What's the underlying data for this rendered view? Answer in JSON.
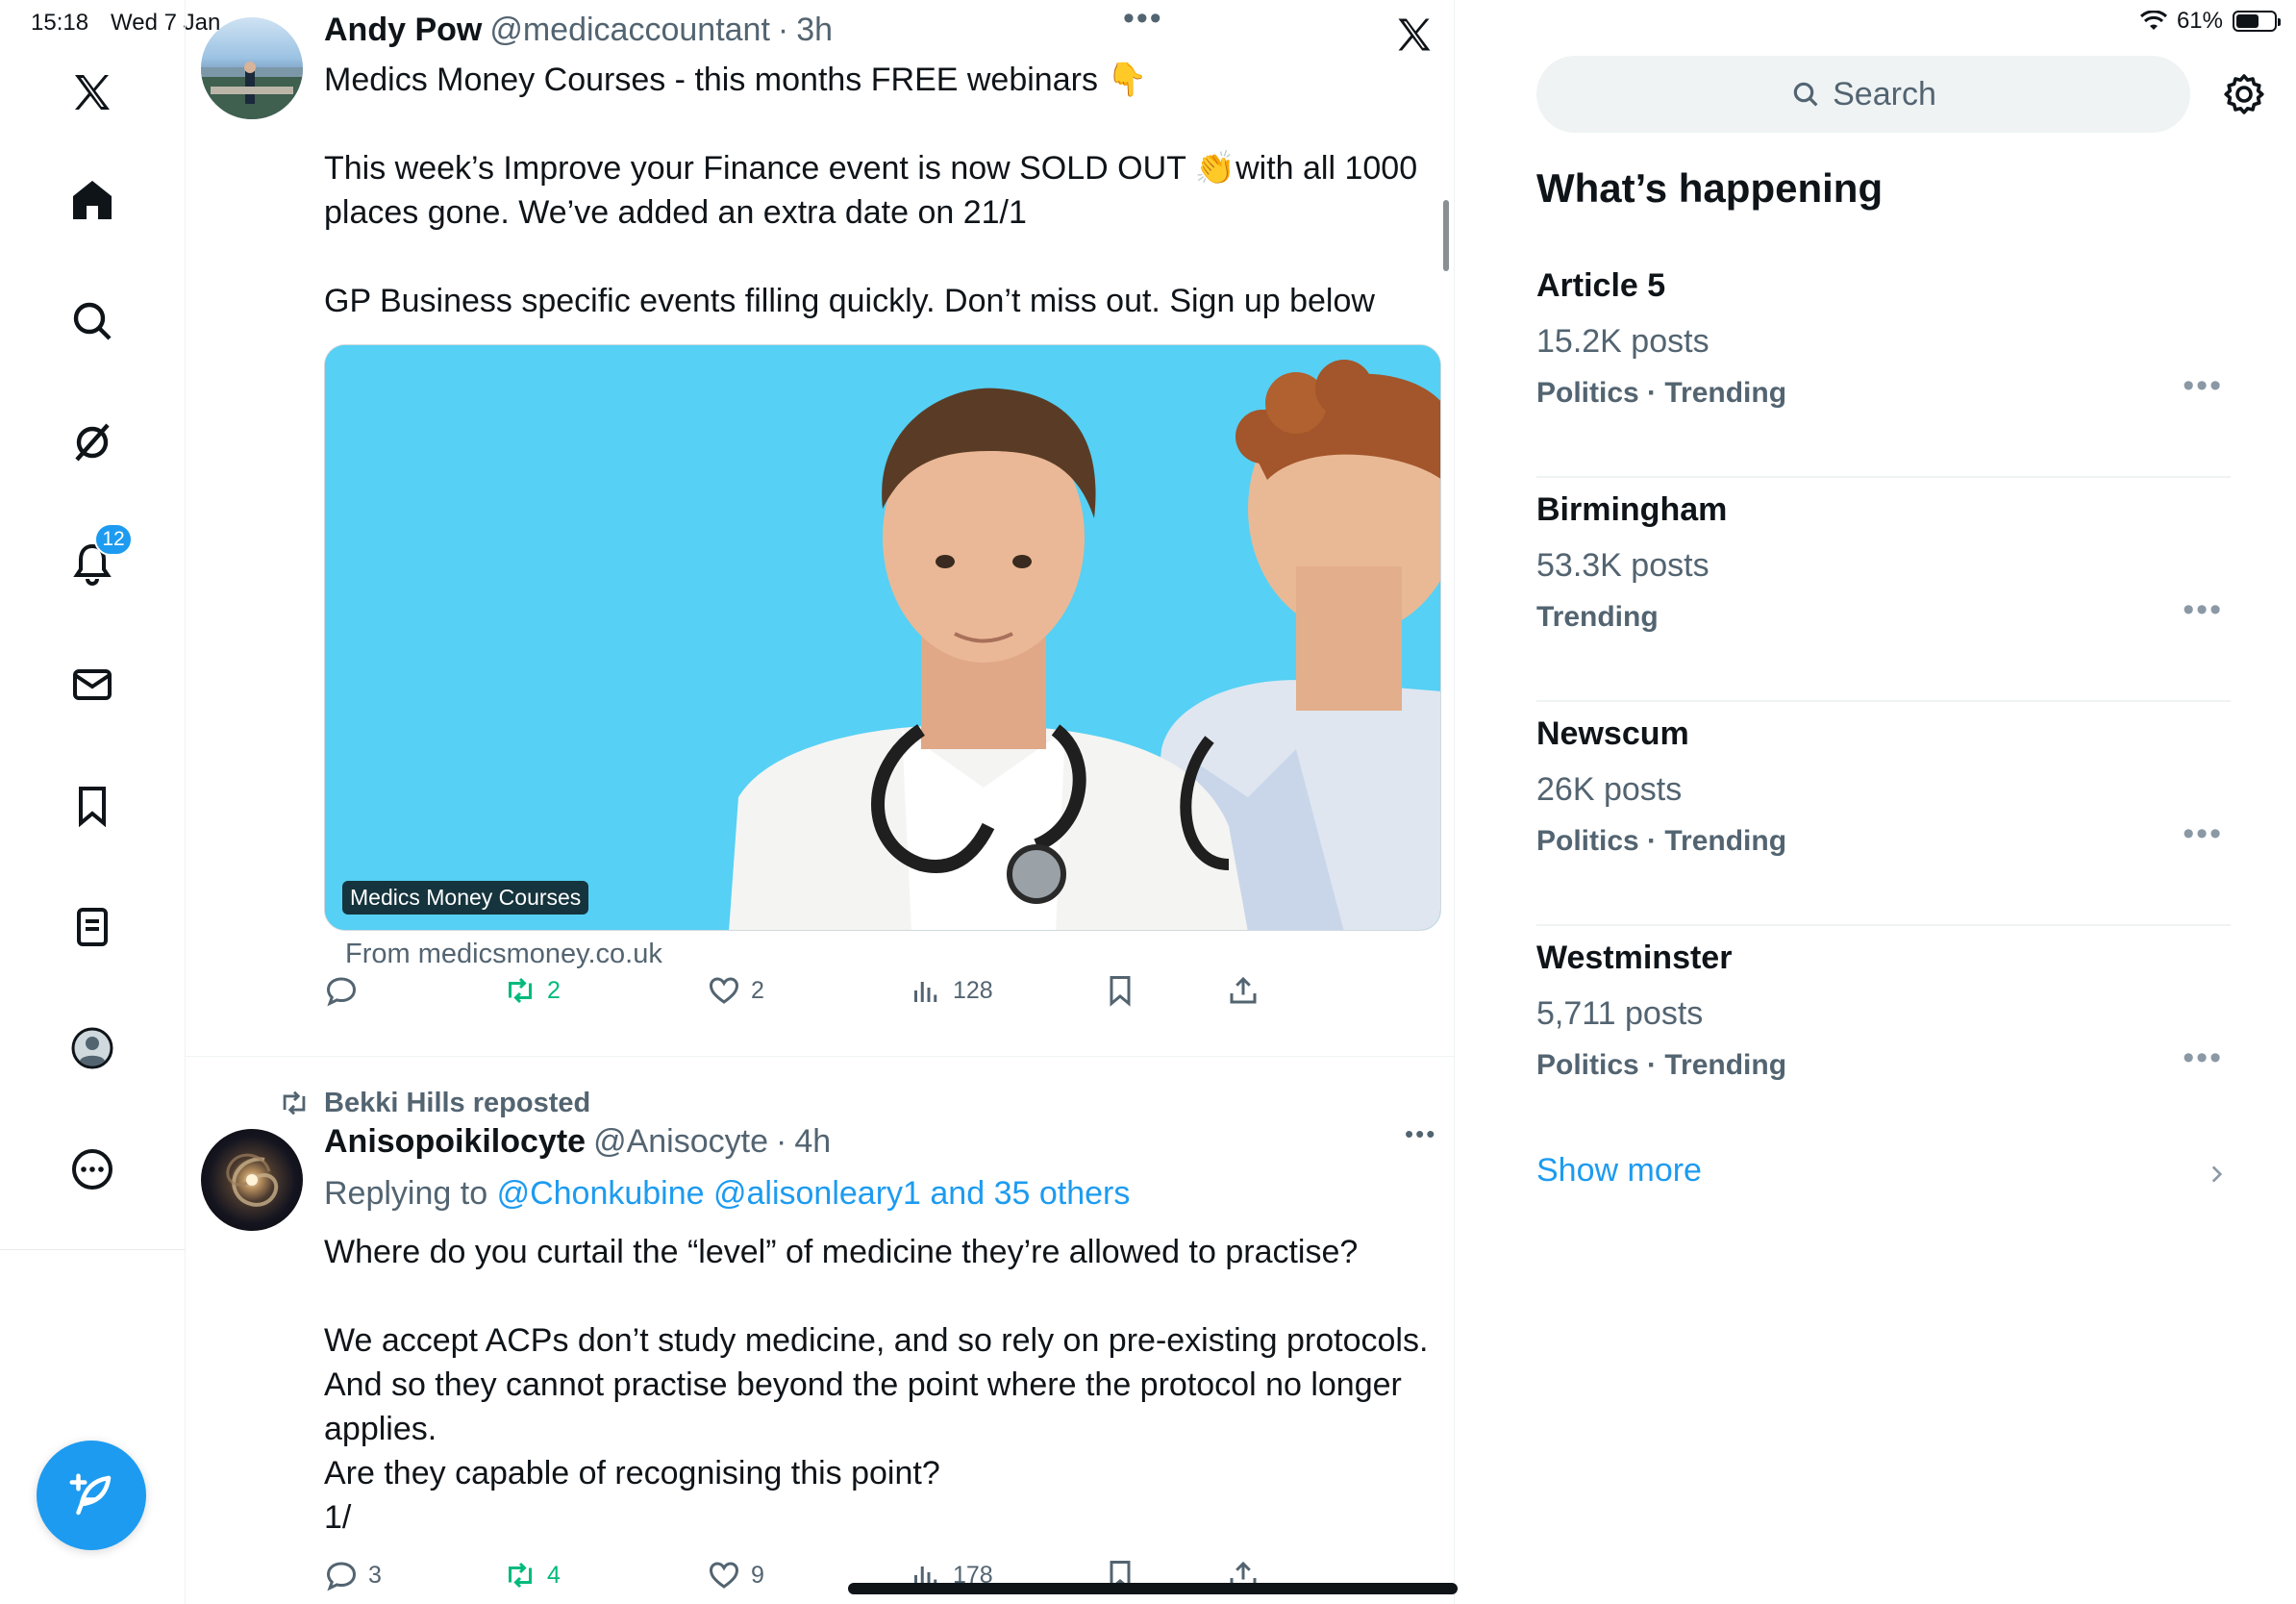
{
  "status_bar": {
    "time": "15:18",
    "date": "Wed 7 Jan",
    "battery": "61%",
    "battery_level": 0.61
  },
  "nav": {
    "notifications_badge": "12",
    "items": [
      "x-logo-icon",
      "home-icon",
      "search-icon",
      "grok-icon",
      "notifications-icon",
      "messages-icon",
      "bookmarks-icon",
      "lists-icon",
      "profile-icon",
      "more-icon"
    ]
  },
  "posts": [
    {
      "display_name": "Andy Pow",
      "handle": "@medicaccountant",
      "time": "3h",
      "text": "Medics Money Courses - this months FREE webinars 👇\n\nThis week’s Improve your Finance event is now SOLD OUT 👏with all 1000 places gone. We’ve added an extra date on 21/1\n\nGP Business specific events filling quickly. Don’t miss out. Sign up below",
      "media_label": "Medics Money Courses",
      "link_source": "From medicsmoney.co.uk",
      "replies": "",
      "reposts": "2",
      "likes": "2",
      "views": "128"
    },
    {
      "reposted_by": "Bekki Hills reposted",
      "display_name": "Anisopoikilocyte",
      "handle": "@Anisocyte",
      "time": "4h",
      "replying_prefix": "Replying to",
      "replying_to": "@Chonkubine @alisonleary1 and 35 others",
      "text": "Where do you curtail the “level” of medicine they’re allowed to practise?\n\nWe accept ACPs don’t study medicine, and so rely on pre-existing protocols. And so they cannot practise beyond the point where the protocol no longer applies.\nAre they capable of recognising this point?\n1/",
      "replies": "3",
      "reposts": "4",
      "likes": "9",
      "views": "178"
    }
  ],
  "sidebar": {
    "search_placeholder": "Search",
    "section_title": "What’s happening",
    "trends": [
      {
        "name": "Article 5",
        "posts": "15.2K posts",
        "category": "Politics · Trending"
      },
      {
        "name": "Birmingham",
        "posts": "53.3K posts",
        "category": "Trending"
      },
      {
        "name": "Newscum",
        "posts": "26K posts",
        "category": "Politics · Trending"
      },
      {
        "name": "Westminster",
        "posts": "5,711 posts",
        "category": "Politics · Trending"
      }
    ],
    "show_more": "Show more"
  },
  "colors": {
    "accent": "#1d9bf0",
    "repost_green": "#00ba7c",
    "secondary_text": "#536471",
    "media_bg": "#56d0f4"
  }
}
